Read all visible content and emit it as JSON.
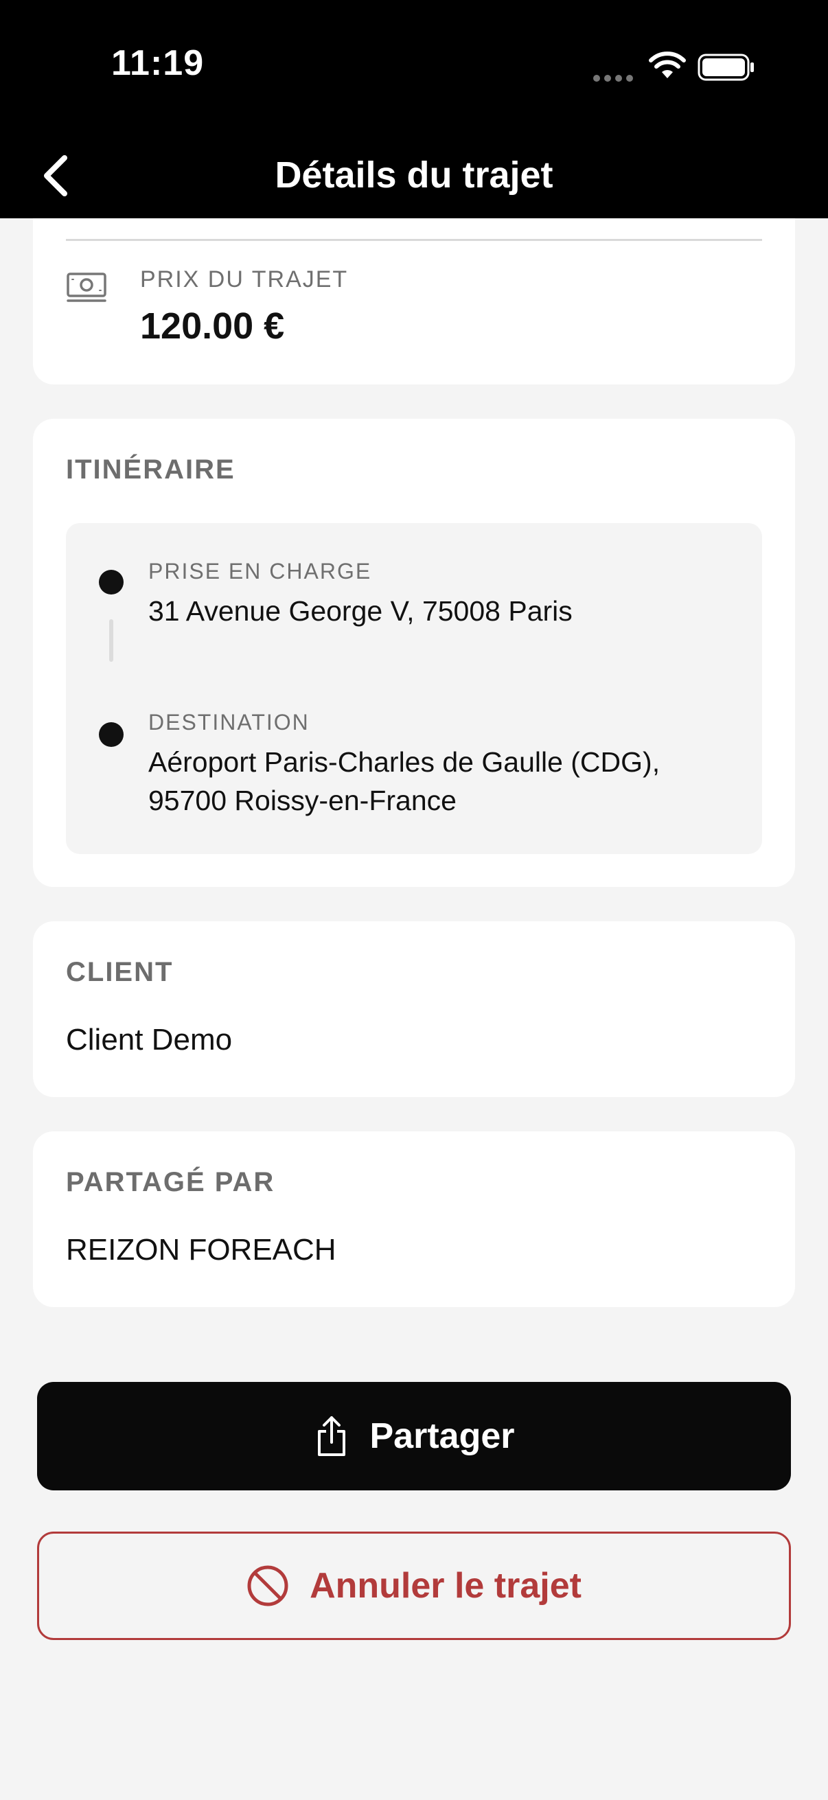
{
  "status_bar": {
    "time": "11:19"
  },
  "nav": {
    "title": "Détails du trajet"
  },
  "price": {
    "label": "PRIX DU TRAJET",
    "value": "120.00 €"
  },
  "itinerary": {
    "title": "ITINÉRAIRE",
    "pickup": {
      "label": "PRISE EN CHARGE",
      "address": "31 Avenue George V, 75008 Paris"
    },
    "destination": {
      "label": "DESTINATION",
      "address": "Aéroport Paris-Charles de Gaulle (CDG), 95700 Roissy-en-France"
    }
  },
  "client": {
    "title": "CLIENT",
    "value": "Client Demo"
  },
  "shared_by": {
    "title": "PARTAGÉ PAR",
    "value": "REIZON FOREACH"
  },
  "actions": {
    "share_label": "Partager",
    "cancel_label": "Annuler le trajet"
  },
  "colors": {
    "accent_danger": "#b23b3b",
    "primary_button": "#0a0a0a",
    "background": "#f4f4f4"
  },
  "icons": {
    "back": "chevron-left-icon",
    "price": "money-icon",
    "share": "share-icon",
    "cancel": "prohibited-icon"
  }
}
